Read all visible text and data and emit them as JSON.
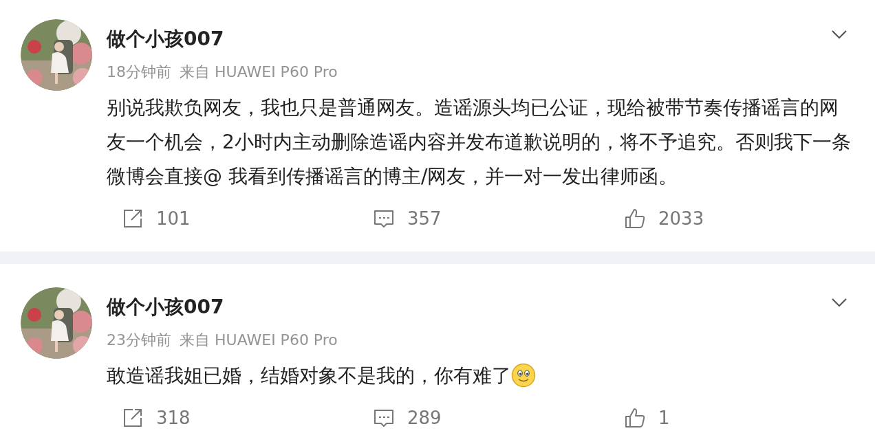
{
  "posts": [
    {
      "author": "做个小孩007",
      "time": "18分钟前",
      "source": "来自 HUAWEI P60 Pro",
      "text": "别说我欺负网友，我也只是普通网友。造谣源头均已公证，现给被带节奏传播谣言的网友一个机会，2小时内主动删除造谣内容并发布道歉说明的，将不予追究。否则我下一条微博会直接@ 我看到传播谣言的博主/网友，并一对一发出律师函。",
      "emoji": false,
      "actions": [
        {
          "kind": "share",
          "count": "101"
        },
        {
          "kind": "comment",
          "count": "357"
        },
        {
          "kind": "like",
          "count": "2033"
        }
      ]
    },
    {
      "author": "做个小孩007",
      "time": "23分钟前",
      "source": "来自 HUAWEI P60 Pro",
      "text": "敢造谣我姐已婚，结婚对象不是我的，你有难了",
      "emoji": true,
      "actions": [
        {
          "kind": "share",
          "count": "318"
        },
        {
          "kind": "comment",
          "count": "289"
        },
        {
          "kind": "like",
          "count": "1"
        }
      ]
    }
  ]
}
